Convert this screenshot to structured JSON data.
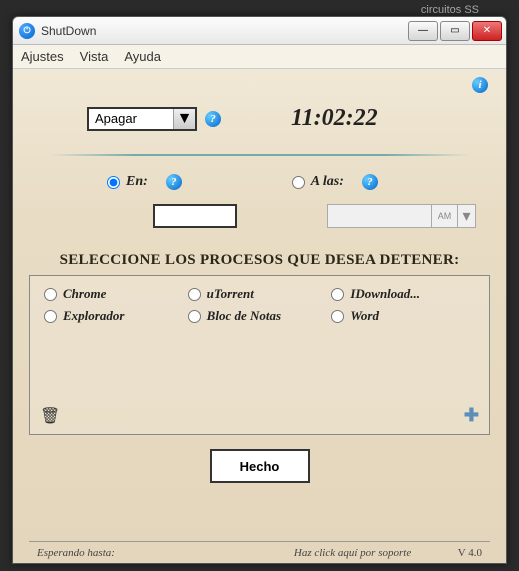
{
  "external": {
    "text": "circuitos SS"
  },
  "window": {
    "title": "ShutDown"
  },
  "menu": {
    "ajustes": "Ajustes",
    "vista": "Vista",
    "ayuda": "Ayuda"
  },
  "action": {
    "selected": "Apagar"
  },
  "clock": {
    "time": "11:02:22"
  },
  "mode": {
    "en_label": "En:",
    "alas_label": "A las:",
    "en_checked": true,
    "alas_checked": false
  },
  "inputs": {
    "duration": "",
    "time": "",
    "ampm": "AM"
  },
  "section": {
    "title": "SELECCIONE LOS PROCESOS QUE DESEA DETENER:"
  },
  "processes": [
    {
      "label": "Chrome"
    },
    {
      "label": "uTorrent"
    },
    {
      "label": "IDownload..."
    },
    {
      "label": "Explorador"
    },
    {
      "label": "Bloc de Notas"
    },
    {
      "label": "Word"
    }
  ],
  "done": {
    "label": "Hecho"
  },
  "status": {
    "left": "Esperando hasta:",
    "mid": "Haz click aquí por soporte",
    "right": "V 4.0"
  }
}
